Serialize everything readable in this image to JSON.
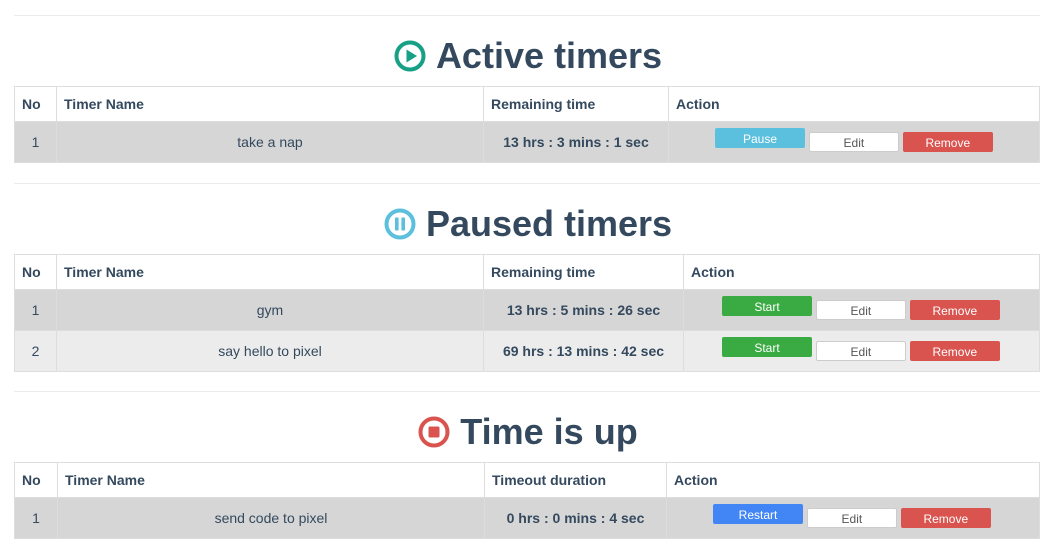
{
  "colors": {
    "active_icon": "#16a085",
    "paused_icon": "#5bc0de",
    "timeup_icon": "#d9534f",
    "heading": "#34495e",
    "btn_pause": "#5bc0de",
    "btn_start": "#3aab42",
    "btn_restart": "#4285f4",
    "btn_remove": "#d9534f"
  },
  "active": {
    "title": "Active timers",
    "icon": "play-circle-icon",
    "headers": {
      "no": "No",
      "name": "Timer Name",
      "time": "Remaining time",
      "action": "Action"
    },
    "rows": [
      {
        "no": "1",
        "name": "take a nap",
        "time": "13 hrs : 3 mins : 1 sec",
        "primary": "Pause",
        "edit": "Edit",
        "remove": "Remove"
      }
    ]
  },
  "paused": {
    "title": "Paused timers",
    "icon": "pause-circle-icon",
    "headers": {
      "no": "No",
      "name": "Timer Name",
      "time": "Remaining time",
      "action": "Action"
    },
    "rows": [
      {
        "no": "1",
        "name": "gym",
        "time": "13 hrs : 5 mins : 26 sec",
        "primary": "Start",
        "edit": "Edit",
        "remove": "Remove"
      },
      {
        "no": "2",
        "name": "say hello to pixel",
        "time": "69 hrs : 13 mins : 42 sec",
        "primary": "Start",
        "edit": "Edit",
        "remove": "Remove"
      }
    ]
  },
  "timeup": {
    "title": "Time is up",
    "icon": "stop-circle-icon",
    "headers": {
      "no": "No",
      "name": "Timer Name",
      "time": "Timeout duration",
      "action": "Action"
    },
    "rows": [
      {
        "no": "1",
        "name": "send code to pixel",
        "time": "0 hrs : 0 mins : 4 sec",
        "primary": "Restart",
        "edit": "Edit",
        "remove": "Remove"
      }
    ]
  }
}
